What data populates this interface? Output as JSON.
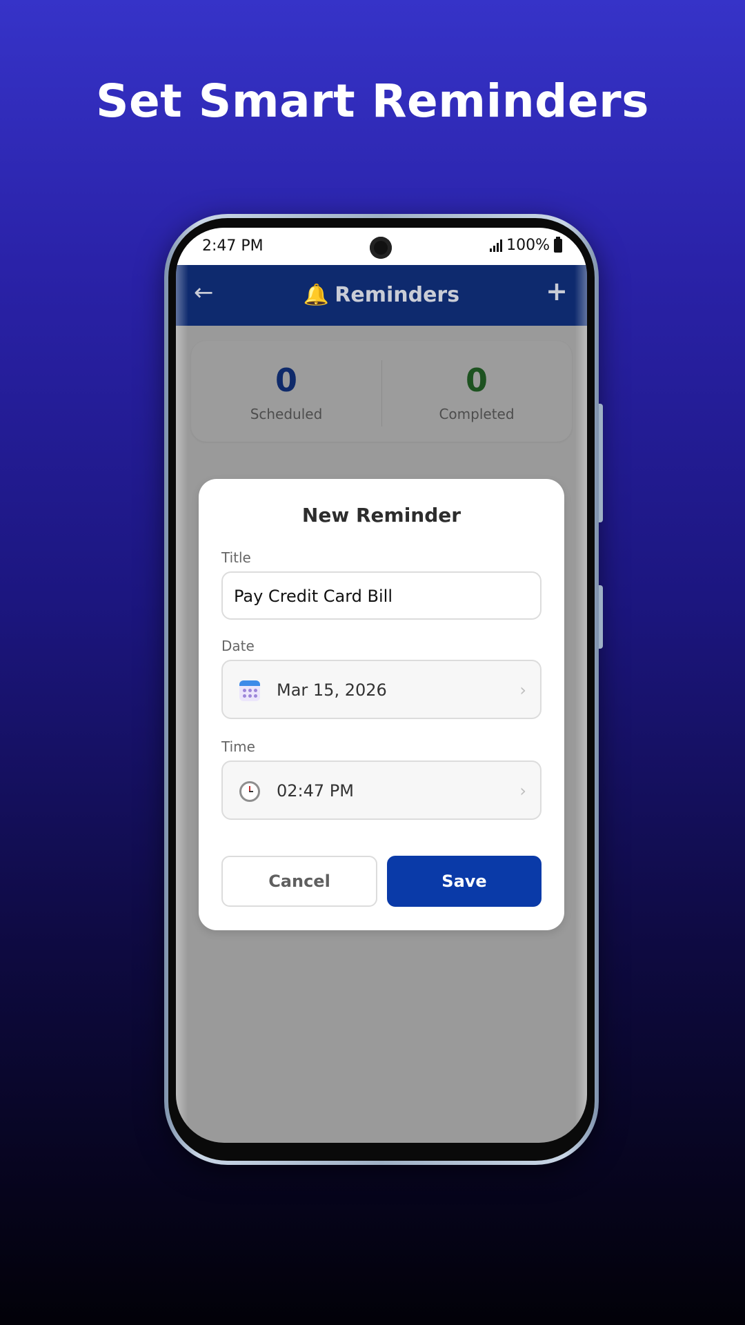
{
  "headline": "Set Smart Reminders",
  "status_bar": {
    "time": "2:47 PM",
    "battery": "100%"
  },
  "app_bar": {
    "back_icon": "←",
    "title": "Reminders",
    "bell_icon": "🔔",
    "add_icon": "+"
  },
  "stats": {
    "scheduled": {
      "value": "0",
      "label": "Scheduled"
    },
    "completed": {
      "value": "0",
      "label": "Completed"
    }
  },
  "modal": {
    "title": "New Reminder",
    "title_field": {
      "label": "Title",
      "value": "Pay Credit Card Bill"
    },
    "date_field": {
      "label": "Date",
      "value": "Mar 15, 2026",
      "icon": "calendar-icon"
    },
    "time_field": {
      "label": "Time",
      "value": "02:47 PM",
      "icon": "clock-icon"
    },
    "chevron": "›",
    "cancel_label": "Cancel",
    "save_label": "Save"
  },
  "colors": {
    "app_bar": "#0e2a6e",
    "save_button": "#0a3aa8",
    "scheduled_number": "#0f2a6a",
    "completed_number": "#1d5220"
  }
}
